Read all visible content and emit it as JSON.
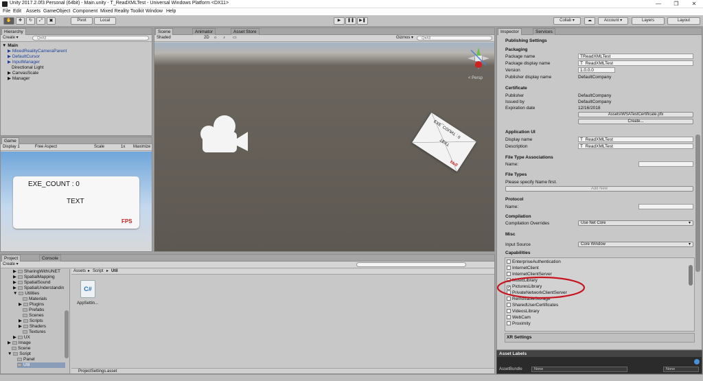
{
  "window": {
    "title": "Unity 2017.2.0f3 Personal (64bit) - Main.unity - T_ReadXMLTest - Universal Windows Platform <DX11>",
    "min": "—",
    "max": "❐",
    "close": "✕"
  },
  "menu": [
    "File",
    "Edit",
    "Assets",
    "GameObject",
    "Component",
    "Mixed Reality Toolkit",
    "Window",
    "Help"
  ],
  "toolbar": {
    "pivot": "Pivot",
    "local": "Local",
    "collab": "Collab ▾",
    "account": "Account ▾",
    "layers": "Layers",
    "layout": "Layout"
  },
  "hierarchy": {
    "tab": "Hierarchy",
    "create": "Create ▾",
    "search": "Q▾All",
    "scene": "Main",
    "items": [
      "MixedRealityCameraParent",
      "DefaultCursor",
      "InputManager",
      "Directional Light",
      "CanvasScale",
      "Manager"
    ]
  },
  "scene": {
    "tabs": [
      "Scene",
      "Animator",
      "Asset Store"
    ],
    "shading": "Shaded",
    "mode": "2D",
    "gizmos": "Gizmos ▾",
    "search": "Q▾All",
    "persp": "< Persp",
    "card_count": "EXE_COUNT : 0",
    "card_text": "TEXT",
    "card_fps": "FPS"
  },
  "game": {
    "tab": "Game",
    "display": "Display 1",
    "aspect": "Free Aspect",
    "scale": "Scale",
    "scale_val": "1x",
    "maximize": "Maximize",
    "exe_count": "EXE_COUNT : 0",
    "text": "TEXT",
    "fps": "FPS"
  },
  "project": {
    "tabs": [
      "Project",
      "Console"
    ],
    "create": "Create ▾",
    "breadcrumb": [
      "Assets",
      "Script",
      "Util"
    ],
    "tree": [
      "SharingWithUNET",
      "SpatialMapping",
      "SpatialSound",
      "SpatialUnderstandin",
      "Utilities",
      "Materials",
      "Plugins",
      "Prefabs",
      "Scenes",
      "Scripts",
      "Shaders",
      "Textures",
      "UX",
      "Image",
      "Scene",
      "Script",
      "Panel",
      "Util"
    ],
    "file": "AppSettin...",
    "file_icon": "C#",
    "status": "ProjectSettings.asset"
  },
  "inspector": {
    "tabs": [
      "Inspector",
      "Services"
    ],
    "title": "Publishing Settings",
    "packaging": {
      "head": "Packaging",
      "rows": [
        [
          "Package name",
          "TReadXMLTest"
        ],
        [
          "Package display name",
          "T_ReadXMLTest"
        ],
        [
          "Version",
          "1.0.0.0"
        ],
        [
          "Publisher display name",
          "DefaultCompany"
        ]
      ]
    },
    "certificate": {
      "head": "Certificate",
      "rows": [
        [
          "Publisher",
          "DefaultCompany"
        ],
        [
          "Issued by",
          "DefaultCompany"
        ],
        [
          "Expiration date",
          "12/16/2018"
        ]
      ],
      "path_btn": "Assets\\WSATestCertificate.pfx",
      "create_btn": "Create..."
    },
    "appui": {
      "head": "Application UI",
      "rows": [
        [
          "Display name",
          "T_ReadXMLTest"
        ],
        [
          "Description",
          "T_ReadXMLTest"
        ]
      ]
    },
    "fta": {
      "head": "File Type Associations",
      "name": "Name:"
    },
    "ft": {
      "head": "File Types",
      "note": "Please specify Name first.",
      "add": "Add New"
    },
    "protocol": {
      "head": "Protocol",
      "name": "Name:"
    },
    "compilation": {
      "head": "Compilation",
      "label": "Compilation Overrides",
      "value": "Use Net Core"
    },
    "misc": {
      "head": "Misc",
      "label": "Input Source",
      "value": "Core Window"
    },
    "capabilities": {
      "head": "Capabilities",
      "items": [
        {
          "name": "EnterpriseAuthentication",
          "checked": false
        },
        {
          "name": "InternetClient",
          "checked": false
        },
        {
          "name": "InternetClientServer",
          "checked": false
        },
        {
          "name": "MusicLibrary",
          "checked": false
        },
        {
          "name": "PicturesLibrary",
          "checked": true
        },
        {
          "name": "PrivateNetworkClientServer",
          "checked": false
        },
        {
          "name": "RemovableStorage",
          "checked": false
        },
        {
          "name": "SharedUserCertificates",
          "checked": false
        },
        {
          "name": "VideosLibrary",
          "checked": false
        },
        {
          "name": "WebCam",
          "checked": false
        },
        {
          "name": "Proximity",
          "checked": false
        }
      ]
    },
    "xr": "XR Settings",
    "asset_labels": "Asset Labels",
    "assetbundle": "AssetBundle",
    "none1": "None",
    "none2": "None"
  },
  "colors": {
    "highlight_ring": "#c8141e",
    "fps": "#c81e1e",
    "sky": "#7fb2e0"
  }
}
